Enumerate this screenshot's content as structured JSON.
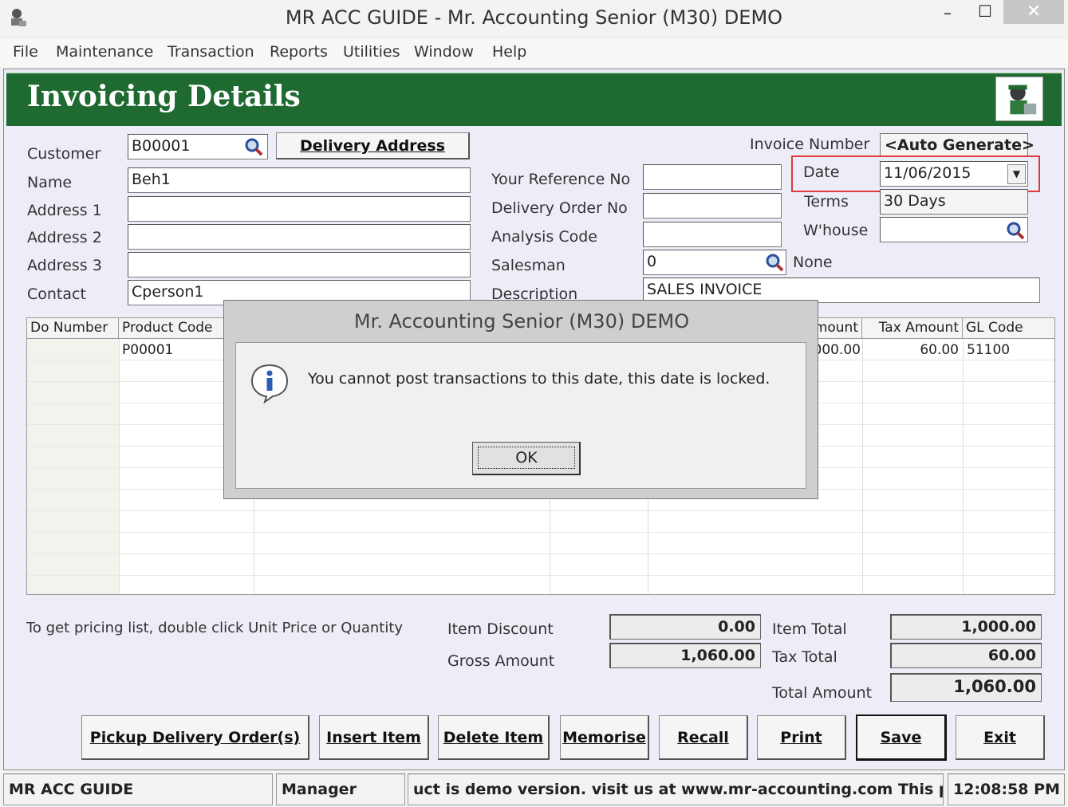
{
  "window": {
    "title": "MR ACC GUIDE - Mr. Accounting Senior (M30) DEMO",
    "minimize": "–",
    "maximize": "☐",
    "close": "✕"
  },
  "menu": [
    "File",
    "Maintenance",
    "Transaction",
    "Reports",
    "Utilities",
    "Window",
    "Help"
  ],
  "page": {
    "title": "Invoicing Details"
  },
  "left_form": {
    "customer_label": "Customer",
    "customer_value": "B00001",
    "delivery_address_button": "Delivery Address",
    "name_label": "Name",
    "name_value": "Beh1",
    "address1_label": "Address 1",
    "address1_value": "",
    "address2_label": "Address 2",
    "address2_value": "",
    "address3_label": "Address 3",
    "address3_value": "",
    "contact_label": "Contact",
    "contact_value": "Cperson1"
  },
  "middle_form": {
    "your_ref_label": "Your Reference No",
    "your_ref_value": "",
    "do_no_label": "Delivery Order No",
    "do_no_value": "",
    "analysis_label": "Analysis Code",
    "analysis_value": "",
    "salesman_label": "Salesman",
    "salesman_value": "0",
    "salesman_name": "None",
    "description_label": "Description",
    "description_value": "SALES INVOICE"
  },
  "right_form": {
    "invoice_no_label": "Invoice Number",
    "invoice_no_value": "<Auto Generate>",
    "date_label": "Date",
    "date_value": "11/06/2015",
    "terms_label": "Terms",
    "terms_value": "30 Days",
    "warehouse_label": "W'house",
    "warehouse_value": ""
  },
  "grid": {
    "columns": [
      "Do Number",
      "Product Code",
      "mount",
      "Tax Amount",
      "GL Code"
    ],
    "row1": {
      "do_number": "",
      "product_code": "P00001",
      "amount": "000.00",
      "tax_amount": "60.00",
      "gl_code": "51100"
    }
  },
  "dialog": {
    "title": "Mr. Accounting Senior (M30) DEMO",
    "message": "You cannot post transactions to this date, this date is locked.",
    "ok": "OK"
  },
  "totals": {
    "hint": "To get pricing list, double click Unit Price or Quantity",
    "item_discount_label": "Item Discount",
    "item_discount_value": "0.00",
    "gross_amount_label": "Gross Amount",
    "gross_amount_value": "1,060.00",
    "item_total_label": "Item Total",
    "item_total_value": "1,000.00",
    "tax_total_label": "Tax Total",
    "tax_total_value": "60.00",
    "total_amount_label": "Total Amount",
    "total_amount_value": "1,060.00"
  },
  "buttons": {
    "pickup": "Pickup Delivery Order(s)",
    "insert": "Insert Item",
    "delete": "Delete Item",
    "memorise": "Memorise",
    "recall": "Recall",
    "print": "Print",
    "save": "Save",
    "exit": "Exit"
  },
  "status": {
    "company": "MR ACC GUIDE",
    "user": "Manager",
    "message": "uct is demo version.  visit us at www.mr-accounting.com This prod",
    "time": "12:08:58 PM"
  },
  "colors": {
    "header_green": "#1e6a30",
    "highlight_red": "#e03a3a",
    "form_bg": "#ededf7"
  },
  "icons": {
    "lookup": "magnifier-icon",
    "app": "accountant-icon",
    "info": "info-icon",
    "dropdown": "chevron-down-icon"
  }
}
